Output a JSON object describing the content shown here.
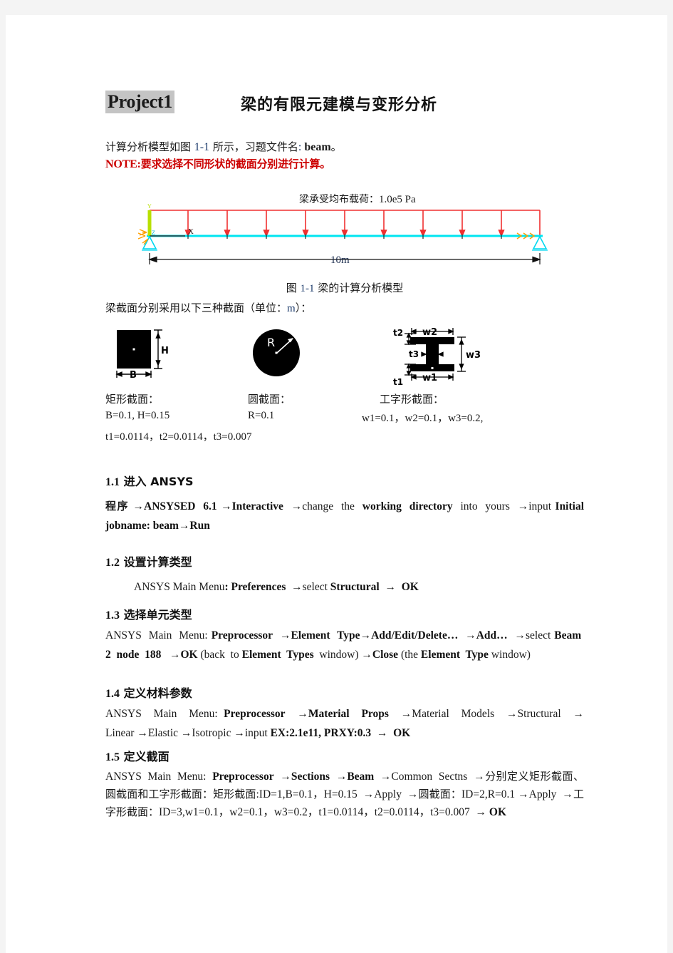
{
  "document": {
    "title_tag": "Project1",
    "title_main": "梁的有限元建模与变形分析",
    "intro_pre": "计算分析模型如图 ",
    "intro_fignum": "1-1",
    "intro_mid": " 所示，习题文件名",
    "intro_colon": ": ",
    "intro_filename": "beam",
    "intro_end": "。",
    "note_label": "NOTE:",
    "note_text": "要求选择不同形状的截面分别进行计算。"
  },
  "figure": {
    "load_label_cn": "梁承受均布载荷：",
    "load_label_value": "1.0e5  Pa",
    "dimension": "10m",
    "caption_pre": "图 ",
    "caption_num": "1-1",
    "caption_post": " 梁的计算分析模型",
    "axis_x": "X",
    "axis_y": "Y",
    "axis_z": "Z",
    "arrow_count": 10,
    "colors": {
      "beam": "#00e5f0",
      "load": "#f03030",
      "support": "#00d8f0",
      "axis_y": "#b8e000",
      "roller": "#ffa000"
    }
  },
  "sections_intro": {
    "text_pre": "梁截面分别采用以下三种截面（单位：",
    "unit": "m",
    "text_post": "）："
  },
  "cross_sections": {
    "rect": {
      "name": "矩形截面：",
      "label_h": "H",
      "label_b": "B",
      "values": "B=0.1, H=0.15"
    },
    "circle": {
      "name": "圆截面：",
      "label_r": "R",
      "values": "R=0.1"
    },
    "ibeam": {
      "name": "工字形截面：",
      "label_t1": "t1",
      "label_t2": "t2",
      "label_t3": "t3",
      "label_w1": "w1",
      "label_w2": "w2",
      "label_w3": "w3",
      "values_line1": "w1=0.1，w2=0.1，w3=0.2,",
      "values_line2": "t1=0.0114，t2=0.0114，t3=0.007"
    }
  },
  "steps": {
    "s11": {
      "num": "1.1",
      "title": "进入 ANSYS",
      "body_html": "程序 →ANSYSED 6.1 →Interactive →change the working directory into yours →input Initial jobname: beam→Run"
    },
    "s12": {
      "num": "1.2",
      "title": "设置计算类型",
      "body_html": "ANSYS Main Menu: Preferences →select Structural → OK"
    },
    "s13": {
      "num": "1.3",
      "title": "选择单元类型",
      "body_html": "ANSYS Main Menu: Preprocessor →Element Type→Add/Edit/Delete… →Add… →select Beam 2 node 188 →OK (back to Element Types window) →Close (the Element Type window)"
    },
    "s14": {
      "num": "1.4",
      "title": "定义材料参数",
      "body_html": "ANSYS Main Menu: Preprocessor →Material Props →Material Models →Structural →Linear →Elastic →Isotropic →input EX:2.1e11, PRXY:0.3 → OK"
    },
    "s15": {
      "num": "1.5",
      "title": "定义截面",
      "body_html": "ANSYS Main Menu: Preprocessor →Sections →Beam →Common Sectns →分别定义矩形截面、圆截面和工字形截面：矩形截面:ID=1,B=0.1，H=0.15 →Apply →圆截面：ID=2,R=0.1 →Apply →工字形截面：ID=3,w1=0.1，w2=0.1，w3=0.2，t1=0.0114，t2=0.0114，t3=0.007 → OK"
    }
  }
}
